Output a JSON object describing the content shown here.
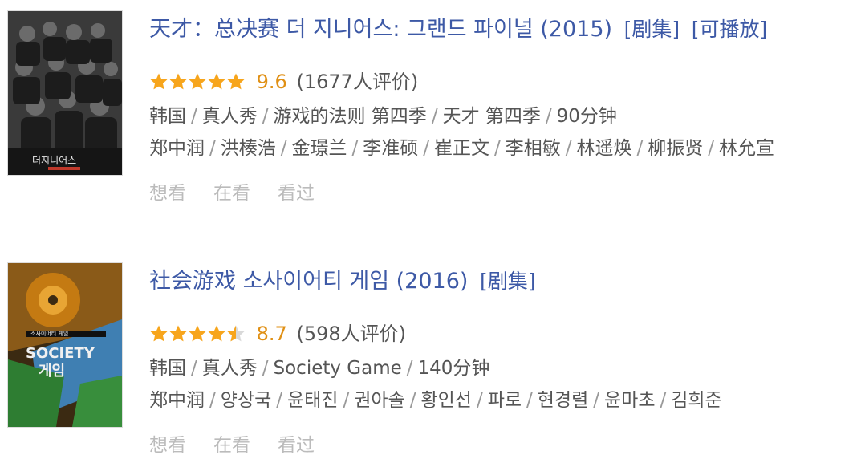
{
  "items": [
    {
      "title": "天才：总决赛 더 지니어스: 그랜드 파이널 (2015)",
      "tags": [
        "[剧集]",
        "[可播放]"
      ],
      "stars": 5,
      "score": "9.6",
      "rating_count": "(1677人评价)",
      "meta_line1": [
        "韩国",
        "真人秀",
        "游戏的法则 第四季",
        "天才 第四季",
        "90分钟"
      ],
      "cast": [
        "郑中润",
        "洪楱浩",
        "金璟兰",
        "李准硕",
        "崔正文",
        "李相敏",
        "林遥焕",
        "柳振贤",
        "林允宣"
      ],
      "actions": [
        "想看",
        "在看",
        "看过"
      ]
    },
    {
      "title": "社会游戏 소사이어티 게임 (2016)",
      "tags": [
        "[剧集]"
      ],
      "stars": 4.5,
      "score": "8.7",
      "rating_count": "(598人评价)",
      "meta_line1": [
        "韩国",
        "真人秀",
        "Society Game",
        "140分钟"
      ],
      "cast": [
        "郑中润",
        "양상국",
        "윤태진",
        "권아솔",
        "황인선",
        "파로",
        "현경렬",
        "윤마초",
        "김희준"
      ],
      "actions": [
        "想看",
        "在看",
        "看过"
      ]
    }
  ],
  "colors": {
    "link": "#3d59a6",
    "tag": "#2f9a5a",
    "star": "#f7a51c",
    "score": "#e09015"
  }
}
